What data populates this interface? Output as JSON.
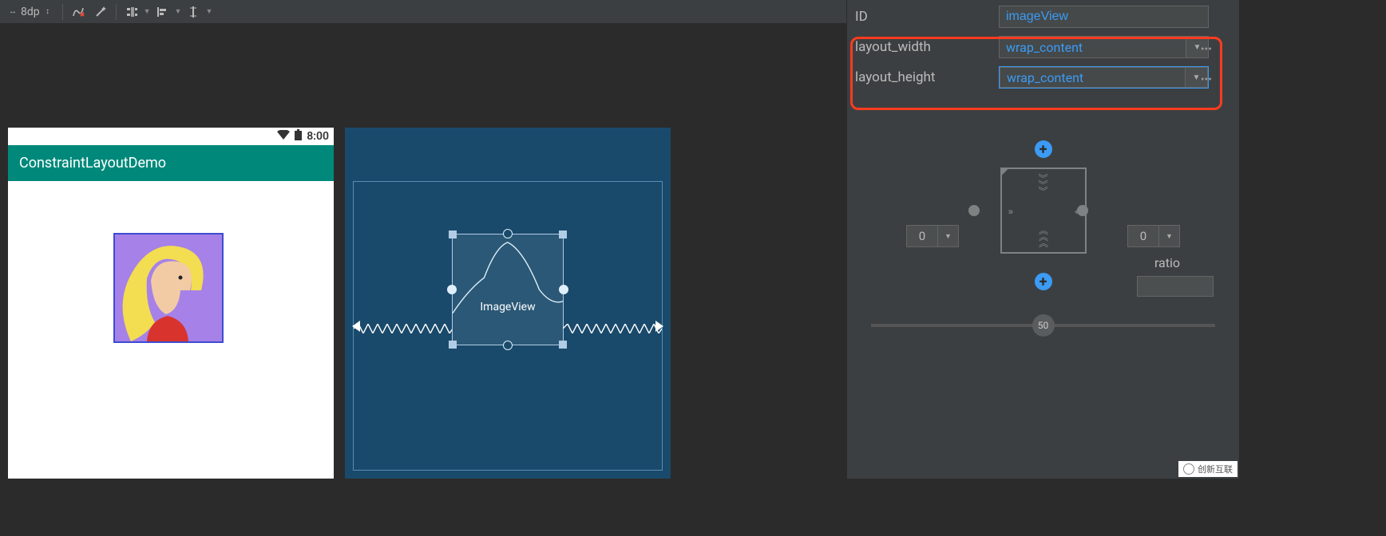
{
  "toolbar": {
    "dp_value": "8dp"
  },
  "device": {
    "status_time": "8:00",
    "app_title": "ConstraintLayoutDemo"
  },
  "blueprint": {
    "view_label": "ImageView"
  },
  "properties": {
    "id": {
      "label": "ID",
      "value": "imageView"
    },
    "layout_width": {
      "label": "layout_width",
      "value": "wrap_content"
    },
    "layout_height": {
      "label": "layout_height",
      "value": "wrap_content"
    },
    "constraint": {
      "left_margin": "0",
      "right_margin": "0",
      "ratio_label": "ratio",
      "bias": "50"
    }
  },
  "watermark": "创新互联"
}
